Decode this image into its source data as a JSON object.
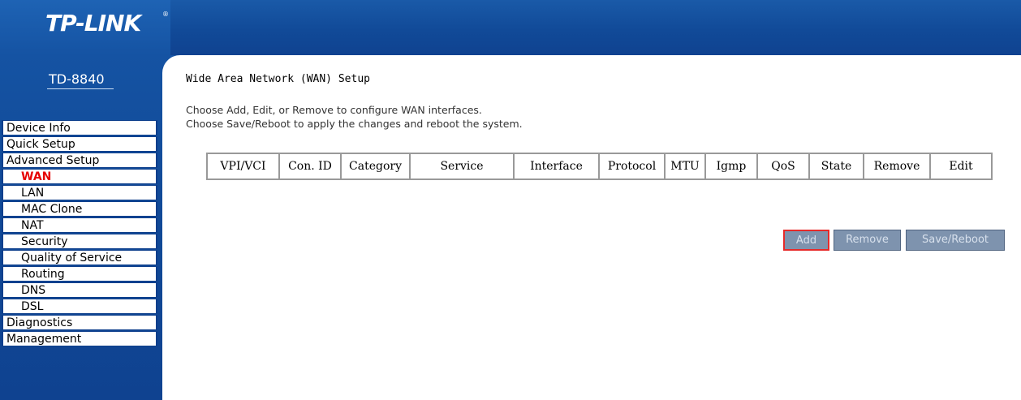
{
  "brand": {
    "logo": "TP-LINK",
    "tm": "®",
    "model": "TD-8840"
  },
  "page": {
    "title": "Wide Area Network (WAN) Setup",
    "desc1": "Choose Add, Edit, or Remove to configure WAN interfaces.",
    "desc2": "Choose Save/Reboot to apply the changes and reboot the system."
  },
  "menu": [
    {
      "label": "Device Info"
    },
    {
      "label": "Quick Setup"
    },
    {
      "label": "Advanced Setup"
    },
    {
      "label": "WAN"
    },
    {
      "label": "LAN"
    },
    {
      "label": "MAC Clone"
    },
    {
      "label": "NAT"
    },
    {
      "label": "Security"
    },
    {
      "label": "Quality of Service"
    },
    {
      "label": "Routing"
    },
    {
      "label": "DNS"
    },
    {
      "label": "DSL"
    },
    {
      "label": "Diagnostics"
    },
    {
      "label": "Management"
    }
  ],
  "table": {
    "headers": [
      "VPI/VCI",
      "Con. ID",
      "Category",
      "Service",
      "Interface",
      "Protocol",
      "MTU",
      "Igmp",
      "QoS",
      "State",
      "Remove",
      "Edit"
    ]
  },
  "buttons": {
    "add": "Add",
    "remove": "Remove",
    "save": "Save/Reboot"
  },
  "colors": {
    "header_blue": "#114a98",
    "active_menu": "#e60000",
    "button_bg": "#7e93ae"
  }
}
